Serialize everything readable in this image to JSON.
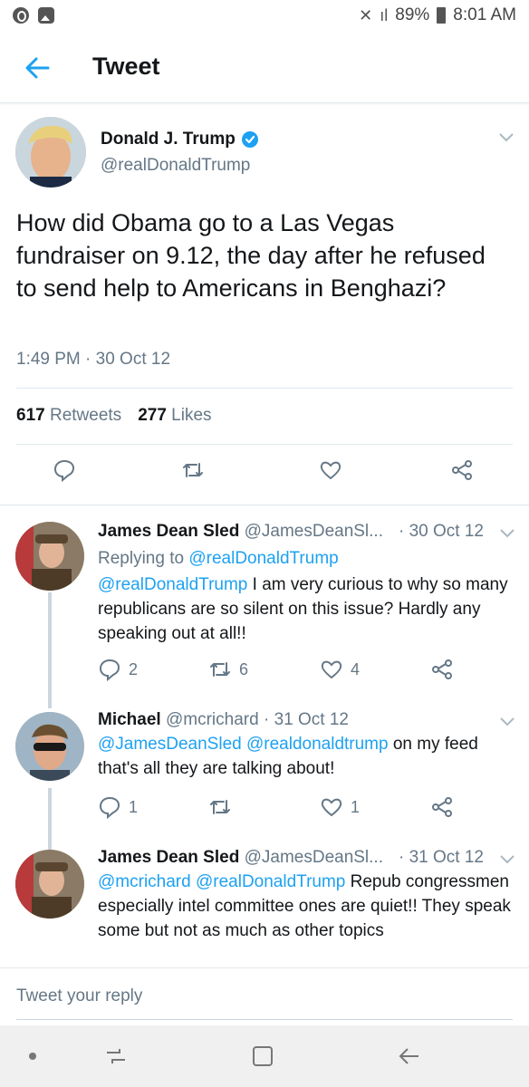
{
  "status_bar": {
    "battery": "89%",
    "time": "8:01 AM"
  },
  "header": {
    "title": "Tweet"
  },
  "tweet": {
    "author_name": "Donald J. Trump",
    "author_handle": "@realDonaldTrump",
    "text": "How did Obama go to a Las Vegas fundraiser on 9.12, the day after he refused to send help to Americans in Benghazi?",
    "timestamp": "1:49 PM · 30 Oct 12",
    "retweets_count": "617",
    "retweets_label": "Retweets",
    "likes_count": "277",
    "likes_label": "Likes"
  },
  "replies": [
    {
      "name": "James Dean Sled",
      "handle": "@JamesDeanSl...",
      "date": "· 30 Oct 12",
      "replying_to_label": "Replying to",
      "replying_to": "@realDonaldTrump",
      "mention": "@realDonaldTrump",
      "text": " I am very curious to why so many republicans are so silent on this issue? Hardly any speaking out at all!!",
      "replies": "2",
      "retweets": "6",
      "likes": "4"
    },
    {
      "name": "Michael",
      "handle": "@mcrichard",
      "date": "· 31 Oct 12",
      "mention1": "@JamesDeanSled",
      "mention2": "@realdonaldtrump",
      "text": " on my feed that's all they are talking about!",
      "replies": "1",
      "retweets": "",
      "likes": "1"
    },
    {
      "name": "James Dean Sled",
      "handle": "@JamesDeanSl...",
      "date": "· 31 Oct 12",
      "mention1": "@mcrichard",
      "mention2": "@realDonaldTrump",
      "text": " Repub congressmen especially intel committee ones are quiet!! They speak some but not as much as other topics"
    }
  ],
  "compose": {
    "placeholder": "Tweet your reply"
  },
  "icons": {
    "back": "arrow-left-icon",
    "verified": "verified-badge-icon",
    "caret": "chevron-down-icon",
    "reply": "reply-bubble-icon",
    "retweet": "retweet-icon",
    "like": "heart-icon",
    "share": "share-icon"
  },
  "colors": {
    "accent": "#1da1f2",
    "text": "#14171a",
    "muted": "#657786",
    "border": "#e1e8ed"
  }
}
